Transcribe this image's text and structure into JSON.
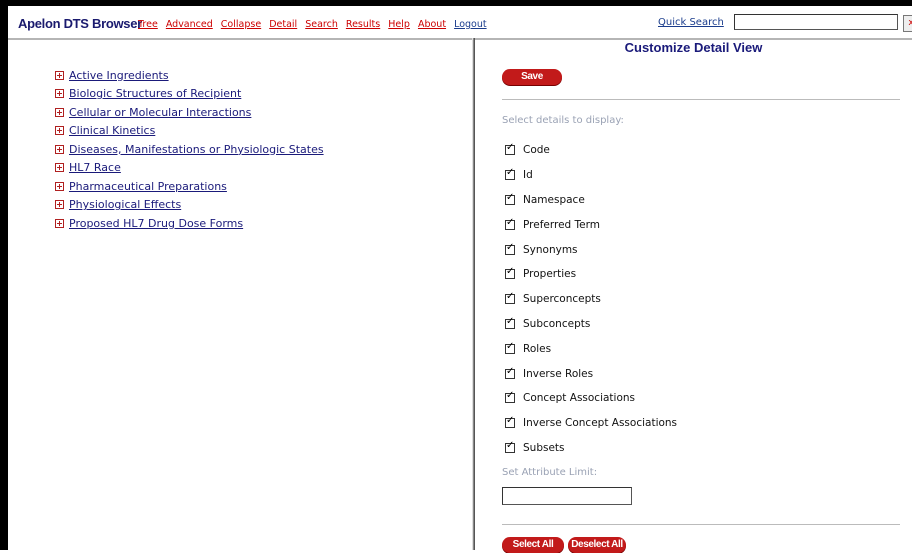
{
  "app": {
    "brand": "Apelon DTS Browser"
  },
  "nav": {
    "items": [
      "Tree",
      "Advanced",
      "Collapse",
      "Detail",
      "Search",
      "Results",
      "Help",
      "About",
      "Logout"
    ]
  },
  "quick_search": {
    "label": "Quick Search",
    "value": "",
    "go_label": "x"
  },
  "tree": {
    "items": [
      "Active Ingredients",
      "Biologic Structures of Recipient",
      "Cellular or Molecular Interactions",
      "Clinical Kinetics",
      "Diseases, Manifestations or Physiologic States",
      "HL7 Race",
      "Pharmaceutical Preparations",
      "Physiological Effects",
      "Proposed HL7 Drug Dose Forms"
    ]
  },
  "detail_panel": {
    "title": "Customize Detail View",
    "save_label": "Save",
    "select_prompt": "Select details to display:",
    "options": [
      {
        "label": "Code",
        "checked": true
      },
      {
        "label": "Id",
        "checked": true
      },
      {
        "label": "Namespace",
        "checked": true
      },
      {
        "label": "Preferred Term",
        "checked": true
      },
      {
        "label": "Synonyms",
        "checked": true
      },
      {
        "label": "Properties",
        "checked": true
      },
      {
        "label": "Superconcepts",
        "checked": true
      },
      {
        "label": "Subconcepts",
        "checked": true
      },
      {
        "label": "Roles",
        "checked": true
      },
      {
        "label": "Inverse Roles",
        "checked": true
      },
      {
        "label": "Concept Associations",
        "checked": true
      },
      {
        "label": "Inverse Concept Associations",
        "checked": true
      },
      {
        "label": "Subsets",
        "checked": true
      }
    ],
    "attribute_limit_label": "Set Attribute Limit:",
    "attribute_limit_value": "",
    "select_all_label": "Select All",
    "deselect_all_label": "Deselect All"
  },
  "colors": {
    "brand": "#1a1a6e",
    "nav_link": "#cc0000",
    "pill_button": "#c21a1a"
  }
}
